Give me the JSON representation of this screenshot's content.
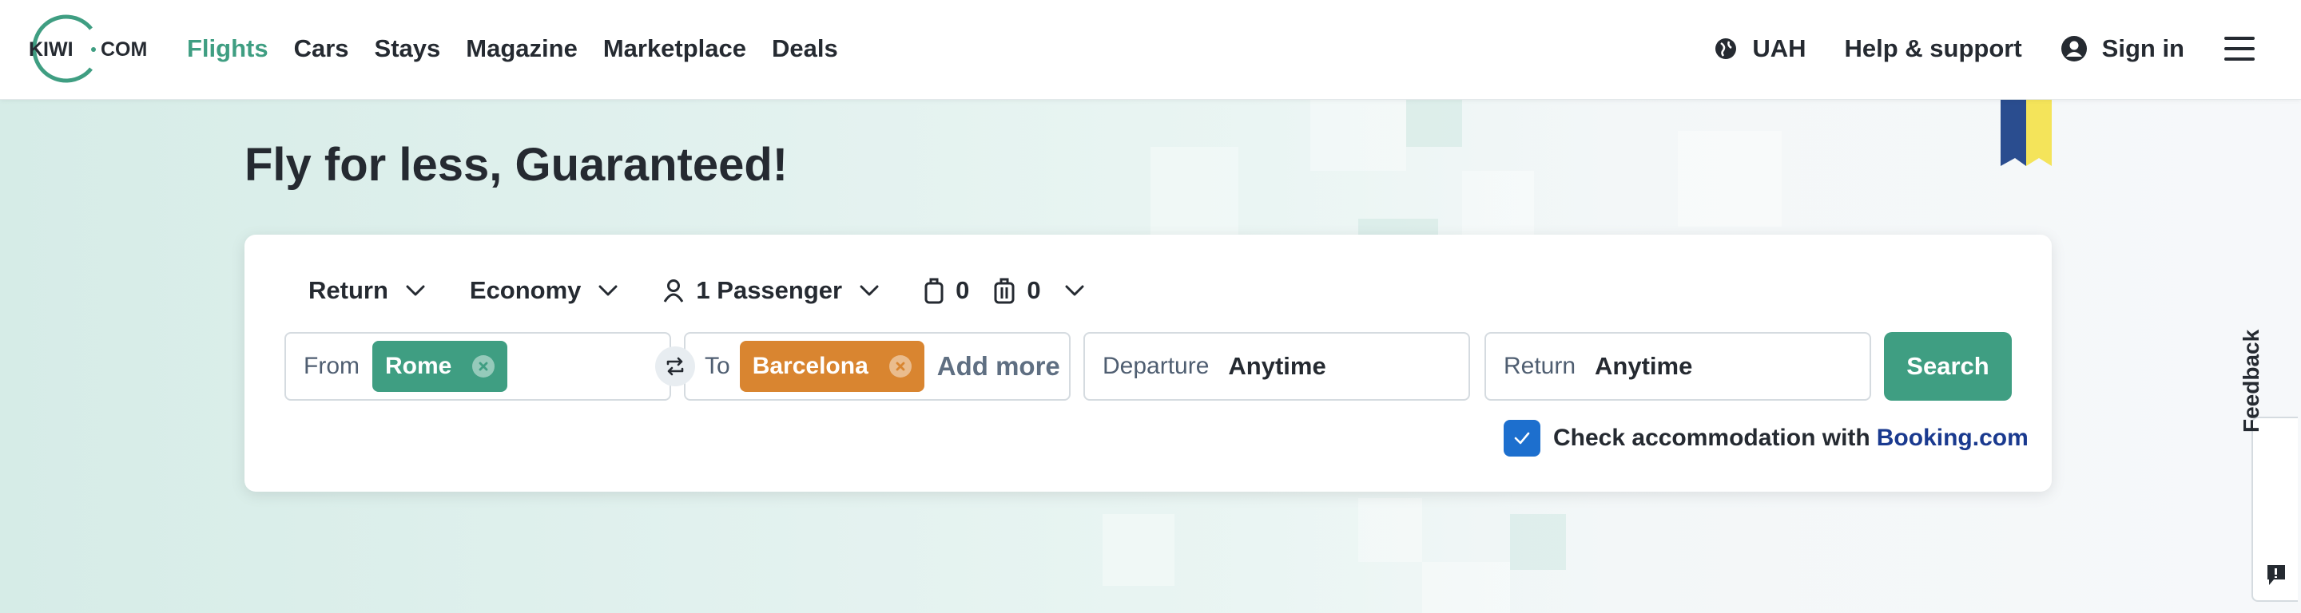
{
  "header": {
    "logo_text": "KIWI·COM",
    "nav": [
      "Flights",
      "Cars",
      "Stays",
      "Magazine",
      "Marketplace",
      "Deals"
    ],
    "active_nav": "Flights",
    "currency": "UAH",
    "help": "Help & support",
    "sign_in": "Sign in"
  },
  "hero": {
    "title": "Fly for less, Guaranteed!"
  },
  "search": {
    "trip_type": "Return",
    "cabin_class": "Economy",
    "passengers": "1 Passenger",
    "cabin_bags": "0",
    "checked_bags": "0",
    "from_label": "From",
    "from_value": "Rome",
    "to_label": "To",
    "to_value": "Barcelona",
    "add_more": "Add more",
    "departure_label": "Departure",
    "departure_value": "Anytime",
    "return_label": "Return",
    "return_value": "Anytime",
    "search_button": "Search",
    "accommodation_label": "Check accommodation with",
    "accommodation_brand": "Booking.com",
    "accommodation_checked": true
  },
  "feedback": {
    "label": "Feedback"
  },
  "colors": {
    "brand": "#3f9e82",
    "from_chip": "#3f9e82",
    "to_chip": "#d98530",
    "checkbox": "#1d6fce",
    "booking": "#1a3a8f"
  }
}
